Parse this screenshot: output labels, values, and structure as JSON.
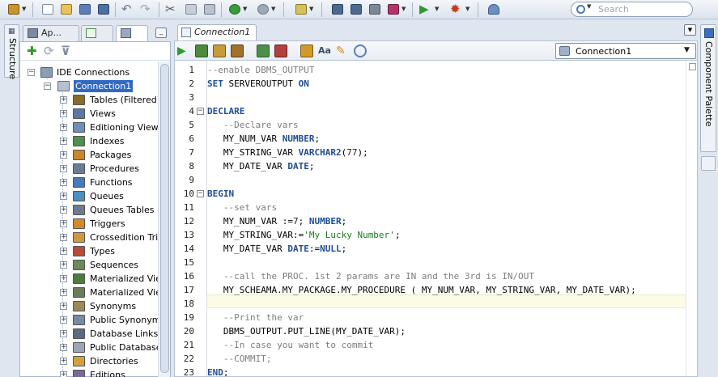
{
  "toolbar": {
    "search_placeholder": "Search"
  },
  "structure_rail": {
    "label": "Structure"
  },
  "left_panel": {
    "tabs": [
      {
        "label": "Ap..."
      },
      {
        "label": ""
      },
      {
        "label": ""
      }
    ],
    "tree": {
      "root": "IDE Connections",
      "connection": "Connection1",
      "nodes": [
        "Tables (Filtered)",
        "Views",
        "Editioning Views",
        "Indexes",
        "Packages",
        "Procedures",
        "Functions",
        "Queues",
        "Queues Tables",
        "Triggers",
        "Crossedition Trigg",
        "Types",
        "Sequences",
        "Materialized Views",
        "Materialized Views",
        "Synonyms",
        "Public Synonyms",
        "Database Links",
        "Public Database L",
        "Directories",
        "Editions"
      ]
    }
  },
  "editor": {
    "tab_label": "Connection1",
    "connection_selector": "Connection1",
    "line_numbers": [
      "1",
      "2",
      "3",
      "4",
      "5",
      "6",
      "7",
      "8",
      "9",
      "10",
      "11",
      "12",
      "13",
      "14",
      "15",
      "16",
      "17",
      "18",
      "19",
      "20",
      "21",
      "22",
      "23"
    ],
    "code": [
      "--enable DBMS_OUTPUT",
      "SET SERVEROUTPUT ON",
      "",
      "DECLARE",
      "   --Declare vars",
      "   MY_NUM_VAR NUMBER;",
      "   MY_STRING_VAR VARCHAR2(77);",
      "   MY_DATE_VAR DATE;",
      "",
      "BEGIN",
      "   --set vars",
      "   MY_NUM_VAR :=7; NUMBER;",
      "   MY_STRING_VAR:='My Lucky Number';",
      "   MY_DATE_VAR DATE:=NULL;",
      "",
      "   --call the PROC. 1st 2 params are IN and the 3rd is IN/OUT",
      "   MY_SCHEAMA.MY_PACKAGE.MY_PROCEDURE ( MY_NUM_VAR, MY_STRING_VAR, MY_DATE_VAR);",
      "",
      "   --Print the var",
      "   DBMS_OUTPUT.PUT_LINE(MY_DATE_VAR);",
      "   --In case you want to commit",
      "   --COMMIT;",
      "END;"
    ]
  },
  "right_rail": {
    "label": "Component Palette"
  },
  "colors": {
    "keyword": "#1e4c93",
    "comment": "#7d7d7d",
    "string": "#1c7a1c",
    "selection": "#316ac5"
  }
}
